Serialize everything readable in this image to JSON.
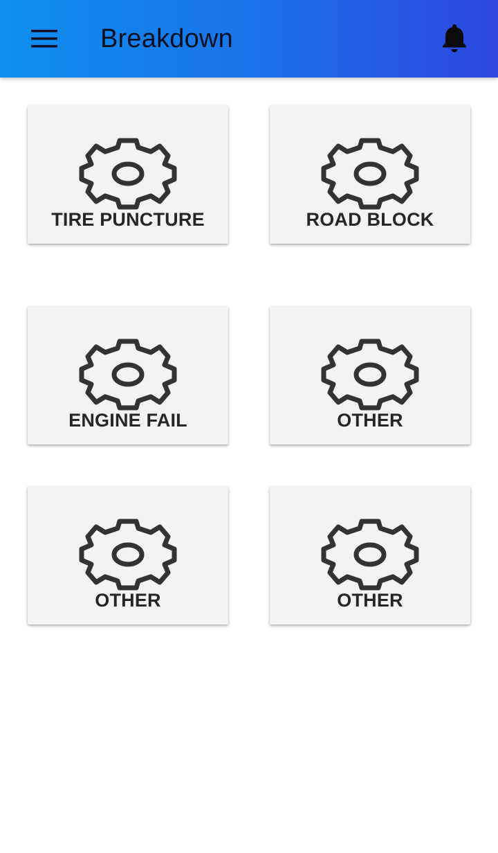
{
  "app_bar": {
    "title": "Breakdown",
    "menu_icon": "menu-icon",
    "notification_icon": "bell-icon",
    "gradient_start": "#0e8ff0",
    "gradient_end": "#2d46e0"
  },
  "cards": [
    {
      "label": "TIRE PUNCTURE",
      "icon": "gear-icon"
    },
    {
      "label": "ROAD BLOCK",
      "icon": "gear-icon"
    },
    {
      "label": "ENGINE FAIL",
      "icon": "gear-icon"
    },
    {
      "label": "OTHER",
      "icon": "gear-icon"
    },
    {
      "label": "OTHER",
      "icon": "gear-icon"
    },
    {
      "label": "OTHER",
      "icon": "gear-icon"
    }
  ],
  "colors": {
    "card_background": "#f3f3f3",
    "icon_color": "#333333",
    "label_color": "#262626"
  }
}
